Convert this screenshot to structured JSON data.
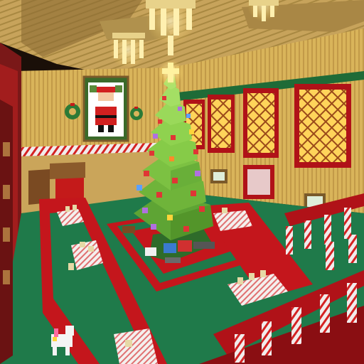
{
  "scene": {
    "description_visible_text": "",
    "palette": {
      "wall": "#d9b45a",
      "wall_stripe": "#b8913f",
      "ceiling": "#c7a35b",
      "floor_green": "#1f7a4a",
      "carpet_red": "#c4161c",
      "balcony_red": "#b01218",
      "candy_white": "#f1ecec",
      "candy_red": "#d42222",
      "tree_green": "#6fb43a",
      "tree_dark": "#4e8e27",
      "window_glow": "#ffd45a",
      "lamp_glow": "#ffe9a0",
      "santa_red": "#d12020"
    },
    "icons": [
      "wreath-icon",
      "santa-painting",
      "christmas-tree",
      "star-topper",
      "chandelier",
      "candy-cane-railing",
      "dining-table",
      "unicorn-figure"
    ]
  }
}
